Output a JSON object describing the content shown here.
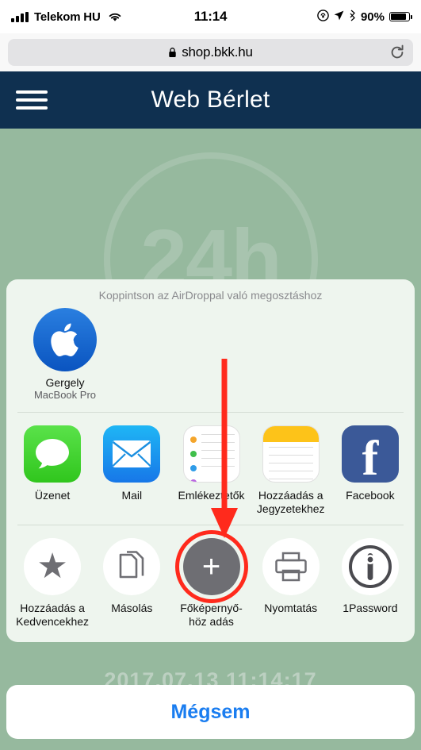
{
  "status_bar": {
    "carrier": "Telekom HU",
    "time": "11:14",
    "battery_percent": "90%",
    "icons": [
      "signal-bars-icon",
      "wifi-icon",
      "screen-rotation-lock-icon",
      "location-arrow-icon",
      "bluetooth-icon",
      "battery-icon"
    ]
  },
  "browser": {
    "url": "shop.bkk.hu",
    "lock_icon": "lock-icon",
    "reload_icon": "reload-icon"
  },
  "app_header": {
    "menu_icon": "hamburger-menu-icon",
    "title": "Web Bérlet"
  },
  "page": {
    "badge_text": "24h",
    "ticket_text": "2017.07.13 11:14:17"
  },
  "share_sheet": {
    "hint": "Koppintson az AirDroppal való megosztáshoz",
    "airdrop": [
      {
        "name": "Gergely",
        "device": "MacBook Pro",
        "icon": "apple-logo-icon"
      }
    ],
    "apps": [
      {
        "label": "Üzenet",
        "icon": "messages-icon"
      },
      {
        "label": "Mail",
        "icon": "mail-icon"
      },
      {
        "label": "Emlékeztetők",
        "icon": "reminders-icon"
      },
      {
        "label": "Hozzáadás a Jegyzetekhez",
        "icon": "notes-icon"
      },
      {
        "label": "Facebook",
        "icon": "facebook-icon"
      }
    ],
    "actions": [
      {
        "label": "Hozzáadás a Kedvencekhez",
        "icon": "star-icon",
        "highlighted": false
      },
      {
        "label": "Másolás",
        "icon": "copy-icon",
        "highlighted": false
      },
      {
        "label": "Főképernyő-höz adás",
        "icon": "add-to-home-screen-icon",
        "highlighted": true
      },
      {
        "label": "Nyomtatás",
        "icon": "printer-icon",
        "highlighted": false
      },
      {
        "label": "1Password",
        "icon": "1password-icon",
        "highlighted": false
      }
    ],
    "cancel_label": "Mégsem",
    "highlight_color": "#ff2a1c",
    "accent_color": "#1a7df0"
  }
}
